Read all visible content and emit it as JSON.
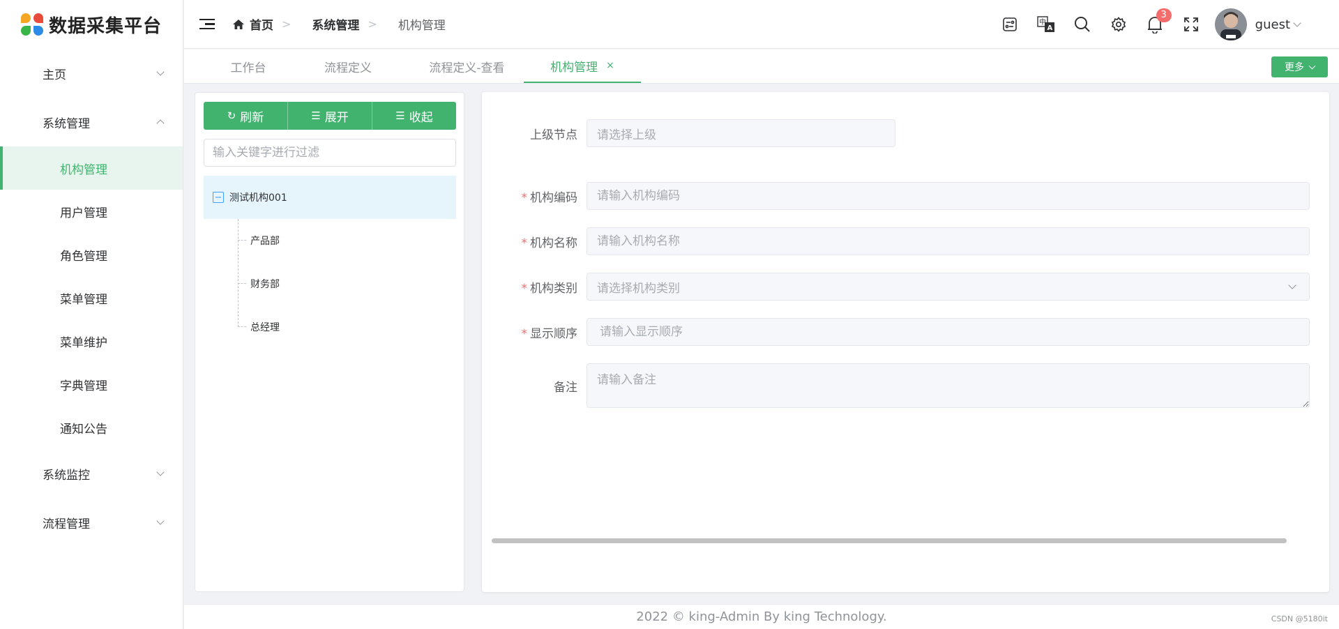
{
  "app": {
    "title": "数据采集平台"
  },
  "sidebar": {
    "groups": [
      {
        "label": "主页",
        "expanded": false
      },
      {
        "label": "系统管理",
        "expanded": true,
        "items": [
          {
            "label": "机构管理",
            "active": true
          },
          {
            "label": "用户管理"
          },
          {
            "label": "角色管理"
          },
          {
            "label": "菜单管理"
          },
          {
            "label": "菜单维护"
          },
          {
            "label": "字典管理"
          },
          {
            "label": "通知公告"
          }
        ]
      },
      {
        "label": "系统监控",
        "expanded": false
      },
      {
        "label": "流程管理",
        "expanded": false
      }
    ]
  },
  "header": {
    "breadcrumb": [
      "首页",
      "系统管理",
      "机构管理"
    ],
    "notification_count": "3",
    "username": "guest",
    "icons": [
      "hamburger-icon",
      "home-icon",
      "layout-icon",
      "translate-icon",
      "search-icon",
      "gear-icon",
      "bell-icon",
      "fullscreen-icon"
    ]
  },
  "tabs": {
    "items": [
      {
        "label": "工作台",
        "active": false
      },
      {
        "label": "流程定义",
        "active": false
      },
      {
        "label": "流程定义-查看",
        "active": false
      },
      {
        "label": "机构管理",
        "active": true,
        "closable": true
      }
    ],
    "close_glyph": "×",
    "more_label": "更多"
  },
  "tree_panel": {
    "buttons": {
      "refresh": "刷新",
      "expand": "展开",
      "collapse": "收起"
    },
    "filter_placeholder": "输入关键字进行过滤",
    "root": {
      "label": "测试机构001",
      "toggle": "−"
    },
    "children": [
      "产品部",
      "财务部",
      "总经理"
    ]
  },
  "form": {
    "parent": {
      "label": "上级节点",
      "placeholder": "请选择上级",
      "required": false
    },
    "code": {
      "label": "机构编码",
      "placeholder": "请输入机构编码",
      "required": true
    },
    "name": {
      "label": "机构名称",
      "placeholder": "请输入机构名称",
      "required": true
    },
    "type": {
      "label": "机构类别",
      "placeholder": "请选择机构类别",
      "required": true
    },
    "order": {
      "label": "显示顺序",
      "placeholder": "请输入显示顺序",
      "required": true
    },
    "remark": {
      "label": "备注",
      "placeholder": "请输入备注",
      "required": false
    },
    "required_mark": "*"
  },
  "footer": {
    "copyright": "2022 © king-Admin By king Technology.",
    "watermark": "CSDN @5180it"
  },
  "colors": {
    "accent": "#41b36f",
    "danger": "#f56c6c",
    "tree_highlight": "#e6f5fc"
  }
}
